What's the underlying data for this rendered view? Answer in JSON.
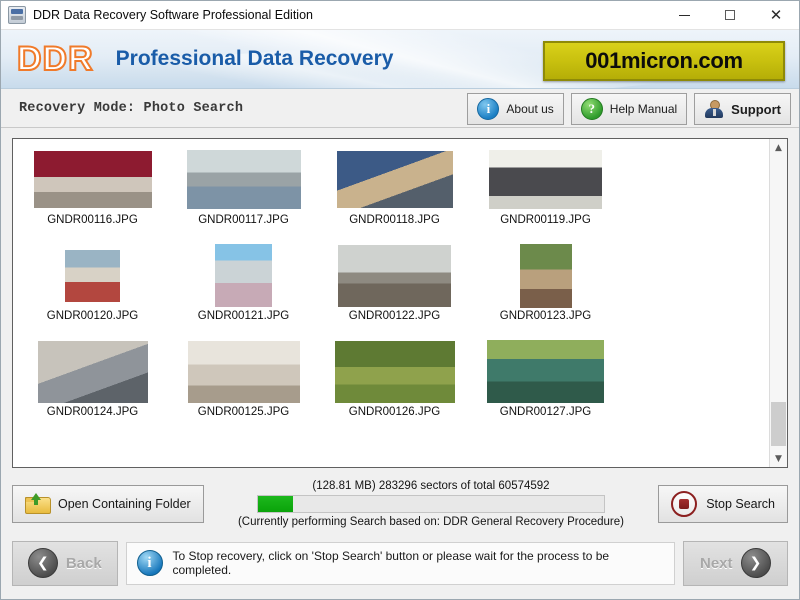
{
  "window": {
    "title": "DDR Data Recovery Software Professional Edition",
    "icon": "app-icon",
    "controls": {
      "minimize": "—",
      "maximize": "□",
      "close": "✕"
    }
  },
  "banner": {
    "logo": "DDR",
    "tagline": "Professional Data Recovery",
    "brand": "001micron.com"
  },
  "mode_bar": {
    "label": "Recovery Mode: Photo Search",
    "buttons": [
      {
        "label": "About us",
        "icon": "info-icon",
        "glyph": "i"
      },
      {
        "label": "Help Manual",
        "icon": "question-icon",
        "glyph": "?"
      },
      {
        "label": "Support",
        "icon": "support-person-icon",
        "glyph": ""
      }
    ]
  },
  "files": [
    {
      "name": "GNDR00116.JPG",
      "w": 118,
      "h": 57,
      "thumb": "c1"
    },
    {
      "name": "GNDR00117.JPG",
      "w": 114,
      "h": 59,
      "thumb": "c2"
    },
    {
      "name": "GNDR00118.JPG",
      "w": 116,
      "h": 57,
      "thumb": "c3"
    },
    {
      "name": "GNDR00119.JPG",
      "w": 113,
      "h": 59,
      "thumb": "c4"
    },
    {
      "name": "GNDR00120.JPG",
      "w": 55,
      "h": 52,
      "thumb": "c5"
    },
    {
      "name": "GNDR00121.JPG",
      "w": 57,
      "h": 63,
      "thumb": "c6"
    },
    {
      "name": "GNDR00122.JPG",
      "w": 113,
      "h": 62,
      "thumb": "c7"
    },
    {
      "name": "GNDR00123.JPG",
      "w": 52,
      "h": 64,
      "thumb": "c8"
    },
    {
      "name": "GNDR00124.JPG",
      "w": 110,
      "h": 62,
      "thumb": "c9"
    },
    {
      "name": "GNDR00125.JPG",
      "w": 112,
      "h": 62,
      "thumb": "c10"
    },
    {
      "name": "GNDR00126.JPG",
      "w": 120,
      "h": 62,
      "thumb": "c11"
    },
    {
      "name": "GNDR00127.JPG",
      "w": 117,
      "h": 63,
      "thumb": "c12"
    }
  ],
  "scrollbar": {
    "up": "▲",
    "down": "▼"
  },
  "progress": {
    "open_folder_label": "Open Containing Folder",
    "status_label": "(128.81 MB) 283296   sectors  of  total 60574592",
    "percent": 10,
    "sub_label": "(Currently performing Search based on:  DDR General Recovery Procedure)",
    "stop_label": "Stop Search",
    "fill_color": "#0aa30a"
  },
  "footer": {
    "back_label": "Back",
    "back_glyph": "❮",
    "next_label": "Next",
    "next_glyph": "❯",
    "message": "To Stop recovery, click on 'Stop Search' button or please wait for the process to be completed.",
    "message_icon": "info-icon",
    "message_glyph": "i"
  }
}
